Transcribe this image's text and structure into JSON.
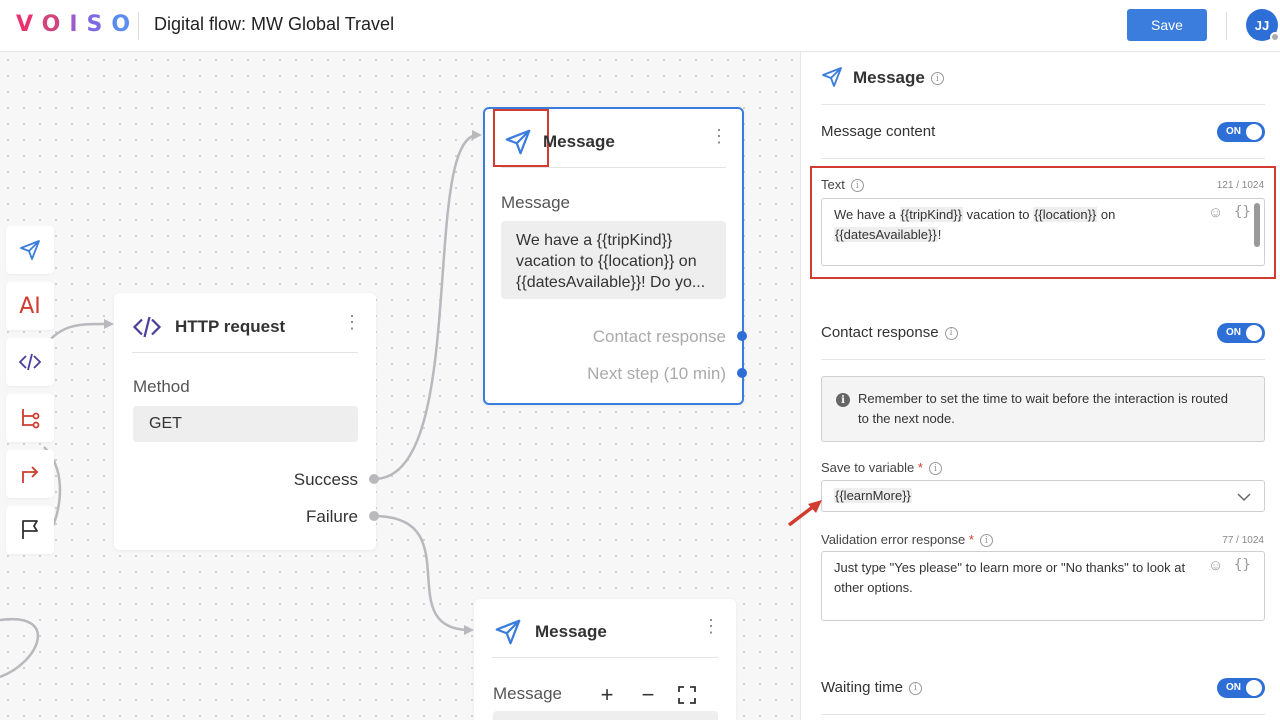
{
  "header": {
    "logo_letters": [
      "V",
      "O",
      "I",
      "S",
      "O"
    ],
    "title": "Digital flow: MW Global Travel",
    "save_label": "Save",
    "avatar_initials": "JJ"
  },
  "toolbar": {
    "items": [
      "message-icon",
      "ai-icon",
      "code-icon",
      "branch-icon",
      "redirect-icon",
      "flag-icon"
    ],
    "ai_label": "AI"
  },
  "nodes": {
    "http_request": {
      "title": "HTTP request",
      "method_label": "Method",
      "method_value": "GET",
      "ports": [
        "Success",
        "Failure"
      ]
    },
    "message_1": {
      "title": "Message",
      "content_label": "Message",
      "preview": "We have a {{tripKind}} vacation to {{location}} on {{datesAvailable}}! Do yo...",
      "ports": [
        "Contact response",
        "Next step (10 min)"
      ]
    },
    "message_2": {
      "title": "Message",
      "content_label": "Message"
    }
  },
  "zoom_controls": [
    "+",
    "−",
    "fit-screen-icon"
  ],
  "panel": {
    "title": "Message",
    "message_content": {
      "label": "Message content",
      "toggle": "ON"
    },
    "text_field": {
      "label": "Text",
      "counter": "121 / 1024",
      "value_parts": [
        "We have a ",
        "{{tripKind}}",
        " vacation to ",
        "{{location}}",
        " on",
        "{{datesAvailable}}",
        "!"
      ]
    },
    "contact_response": {
      "label": "Contact response",
      "toggle": "ON",
      "notice": "Remember to set the time to wait before the interaction is routed to the next node."
    },
    "save_to_variable": {
      "label": "Save to variable",
      "required": "*",
      "value": "{{learnMore}}"
    },
    "validation": {
      "label": "Validation error response",
      "required": "*",
      "counter": "77 / 1024",
      "value": "Just type \"Yes please\" to learn more or \"No thanks\" to look at other options."
    },
    "waiting_time": {
      "label": "Waiting time",
      "toggle": "ON"
    }
  },
  "colors": {
    "accent": "#2d6fd6",
    "save_button": "#3b7ddd",
    "highlight": "#d23b2f",
    "canvas_bg": "#f7f7f8"
  }
}
